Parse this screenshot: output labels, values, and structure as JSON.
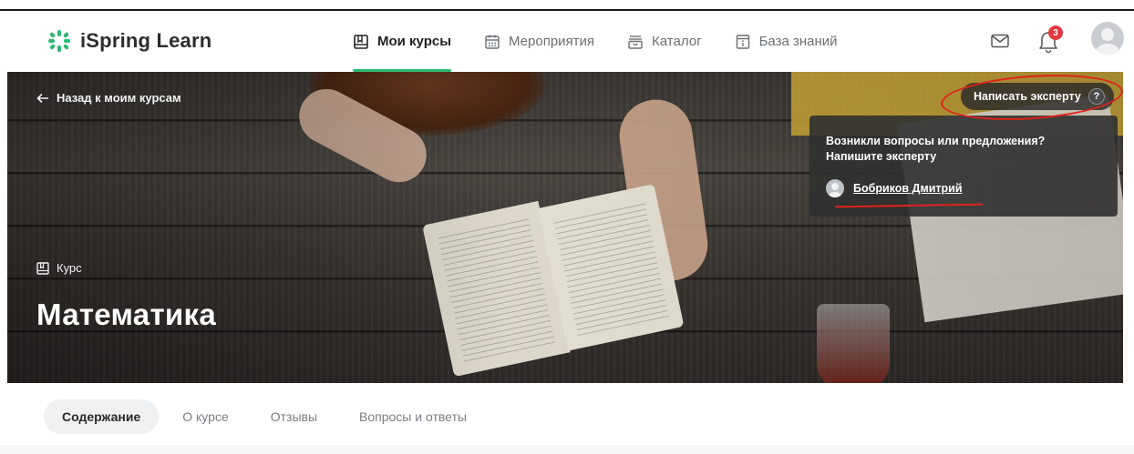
{
  "app": {
    "name": "iSpring Learn",
    "accent_color": "#2eb872"
  },
  "nav": [
    {
      "label": "Мои курсы",
      "icon": "book-icon",
      "active": true
    },
    {
      "label": "Мероприятия",
      "icon": "calendar-icon",
      "active": false
    },
    {
      "label": "Каталог",
      "icon": "catalog-icon",
      "active": false
    },
    {
      "label": "База знаний",
      "icon": "knowledge-icon",
      "active": false
    }
  ],
  "header": {
    "notifications_count": "3",
    "mail_icon": "mail-icon",
    "bell_icon": "bell-icon"
  },
  "hero": {
    "back_label": "Назад к моим курсам",
    "course_kind": "Курс",
    "course_title": "Математика",
    "expert_button": "Написать эксперту",
    "help_glyph": "?"
  },
  "popup": {
    "text": "Возникли вопросы или предложения? Напишите эксперту",
    "expert_name": "Бобриков Дмитрий"
  },
  "tabs": [
    {
      "label": "Содержание",
      "active": true
    },
    {
      "label": "О курсе",
      "active": false
    },
    {
      "label": "Отзывы",
      "active": false
    },
    {
      "label": "Вопросы и ответы",
      "active": false
    }
  ]
}
